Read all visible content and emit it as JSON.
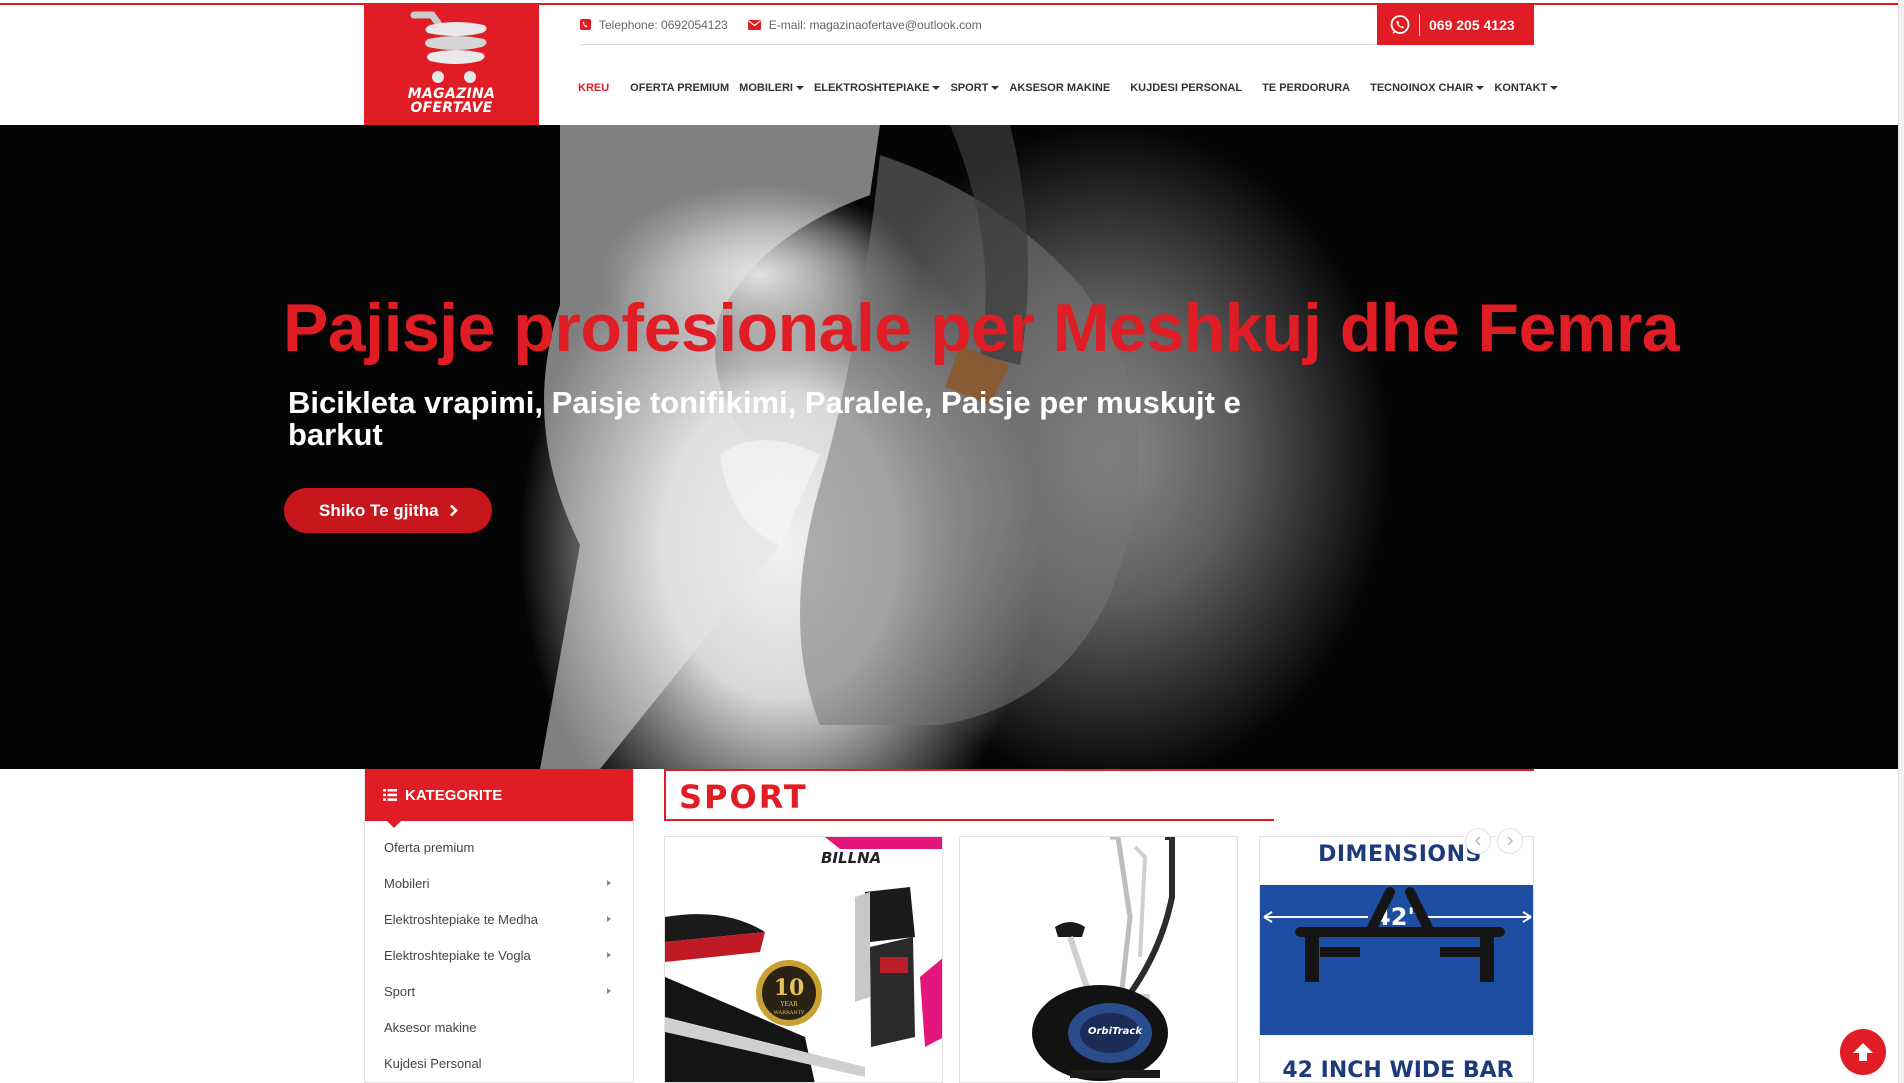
{
  "logo": {
    "line1": "MAGAZINA",
    "line2": "OFERTAVE"
  },
  "contact": {
    "phone_label": "Telephone: 0692054123",
    "email_label": "E-mail: magazinaofertave@outlook.com"
  },
  "whatsapp": {
    "number": "069 205 4123",
    "icon": "whatsapp-icon"
  },
  "nav": [
    {
      "label": "KREU",
      "active": true,
      "dropdown": false
    },
    {
      "label": "OFERTA PREMIUM",
      "active": false,
      "dropdown": false
    },
    {
      "label": "MOBILERI",
      "active": false,
      "dropdown": true
    },
    {
      "label": "ELEKTROSHTEPIAKE",
      "active": false,
      "dropdown": true
    },
    {
      "label": "SPORT",
      "active": false,
      "dropdown": true
    },
    {
      "label": "AKSESOR MAKINE",
      "active": false,
      "dropdown": false
    },
    {
      "label": "KUJDESI PERSONAL",
      "active": false,
      "dropdown": false
    },
    {
      "label": "TE PERDORURA",
      "active": false,
      "dropdown": false
    },
    {
      "label": "TECNOINOX CHAIR",
      "active": false,
      "dropdown": true
    },
    {
      "label": "KONTAKT",
      "active": false,
      "dropdown": true
    }
  ],
  "hero": {
    "title": "Pajisje profesionale per Meshkuj dhe Femra",
    "subtitle": "Bicikleta vrapimi, Paisje tonifikimi, Paralele, Paisje per muskujt e barkut",
    "button_label": "Shiko Te gjitha"
  },
  "sidebar": {
    "title": "KATEGORITE",
    "items": [
      {
        "label": "Oferta premium",
        "has_submenu": false
      },
      {
        "label": "Mobileri",
        "has_submenu": true
      },
      {
        "label": "Elektroshtepiake te Medha",
        "has_submenu": true
      },
      {
        "label": "Elektroshtepiake te Vogla",
        "has_submenu": true
      },
      {
        "label": "Sport",
        "has_submenu": true
      },
      {
        "label": "Aksesor makine",
        "has_submenu": false
      },
      {
        "label": "Kujdesi Personal",
        "has_submenu": false
      }
    ]
  },
  "section": {
    "title": "SPORT"
  },
  "products": {
    "p1": {
      "brand": "BILLNA",
      "badge_top": "10",
      "badge_mid": "YEAR",
      "badge_bot": "WARRANTY"
    },
    "p2": {
      "brand": "OrbiTrack"
    },
    "p3": {
      "top_text": "DIMENSIONS",
      "width_label": "42\"",
      "bottom_text": "42 INCH WIDE BAR"
    }
  },
  "colors": {
    "accent": "#e01c24",
    "dark": "#050505"
  }
}
